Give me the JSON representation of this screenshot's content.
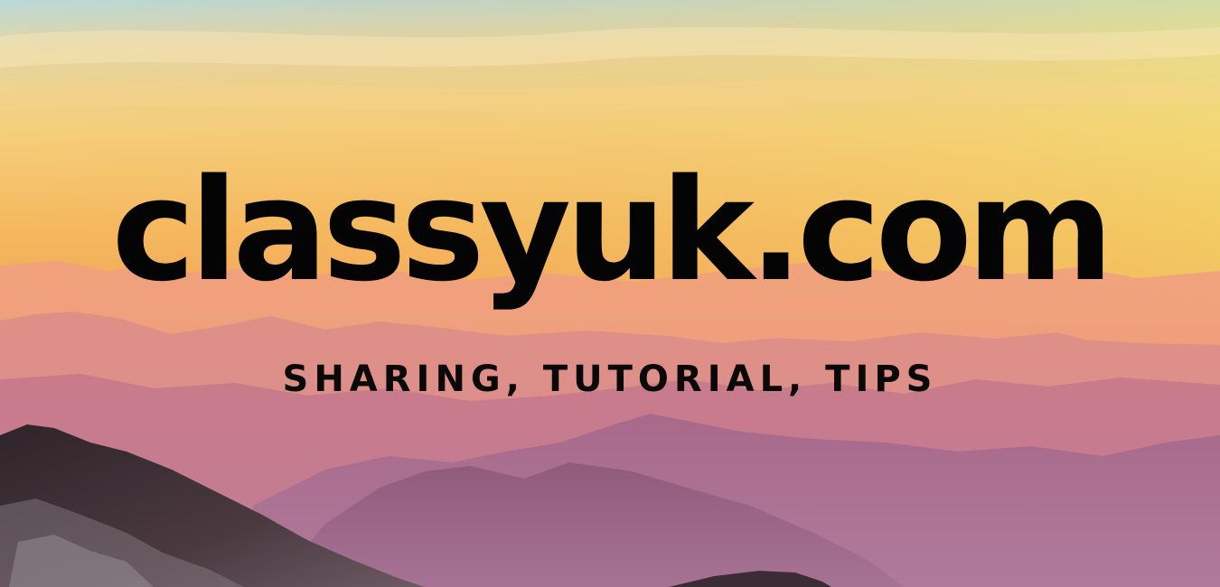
{
  "banner": {
    "title": "classyuk.com",
    "tagline": "SHARING, TUTORIAL, TIPS"
  },
  "colors": {
    "sky_top": "#b9d9d8",
    "sky_mid": "#f5cf7c",
    "sky_low": "#f4a85a",
    "haze_pink": "#e9a08f",
    "mountain_mauve": "#b3728c",
    "mountain_purple": "#8e5a7c",
    "rock_dark": "#3a2e33",
    "text": "#050404"
  }
}
